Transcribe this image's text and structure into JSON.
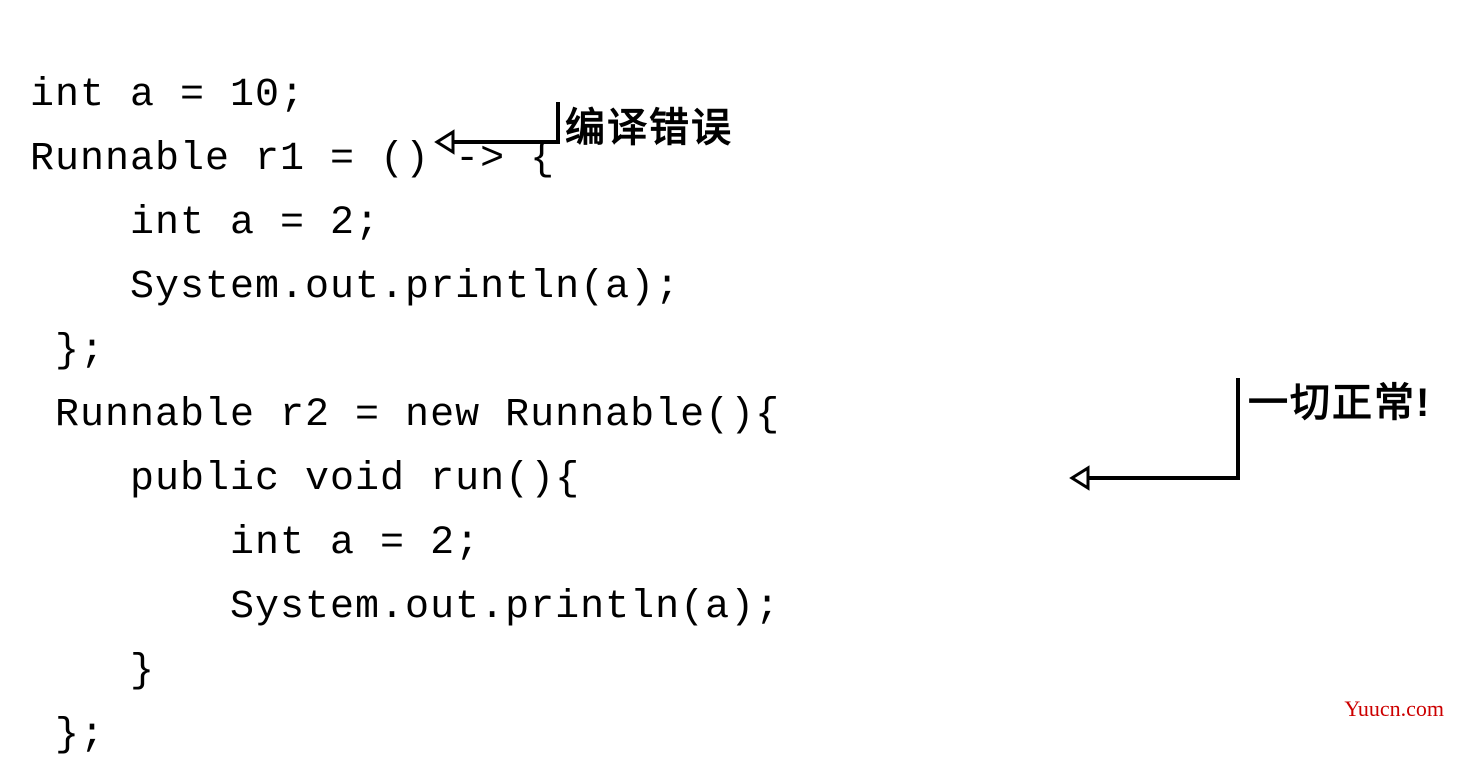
{
  "code": {
    "line1": "int a = 10;",
    "line2": "Runnable r1 = () -> {",
    "line3": "    int a = 2;",
    "line4": "    System.out.println(a);",
    "line5": " };",
    "line6": " Runnable r2 = new Runnable(){",
    "line7": "    public void run(){",
    "line8": "        int a = 2;",
    "line9": "        System.out.println(a);",
    "line10": "    }",
    "line11": " };"
  },
  "annotations": {
    "compile_error": "编译错误",
    "all_ok": "一切正常!"
  },
  "watermark": "Yuucn.com"
}
